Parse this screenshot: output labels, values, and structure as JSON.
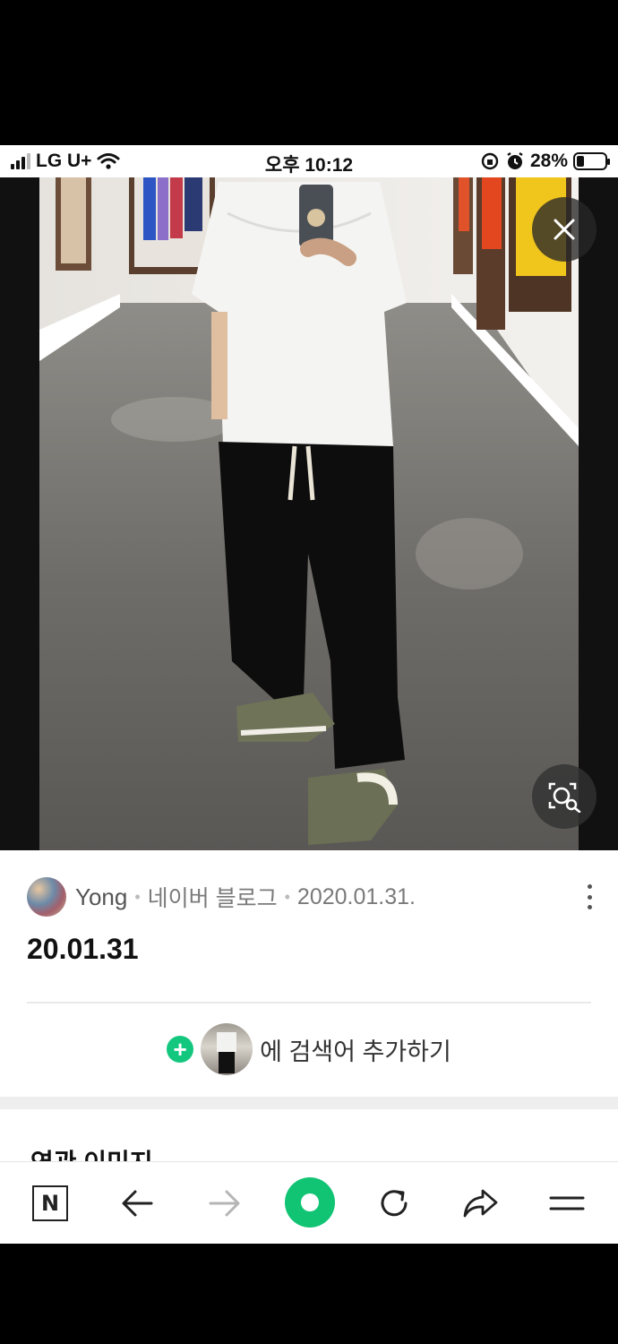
{
  "status_bar": {
    "carrier": "LG U+",
    "time": "오후 10:12",
    "battery": "28%",
    "battery_level": 0.28
  },
  "viewer": {
    "close_label": "close-icon",
    "lens_label": "image-search-icon"
  },
  "post": {
    "author": "Yong",
    "source": "네이버 블로그",
    "date": "2020.01.31.",
    "caption": "20.01.31",
    "add_search_text": "에 검색어 추가하기"
  },
  "related": {
    "title": "연관 이미지"
  },
  "toolbar": {
    "home_label": "N",
    "items": [
      "naver-home",
      "back",
      "forward",
      "green-dot",
      "refresh",
      "share",
      "menu"
    ]
  },
  "colors": {
    "accent_green": "#11c474",
    "plus_green": "#14c77f"
  }
}
